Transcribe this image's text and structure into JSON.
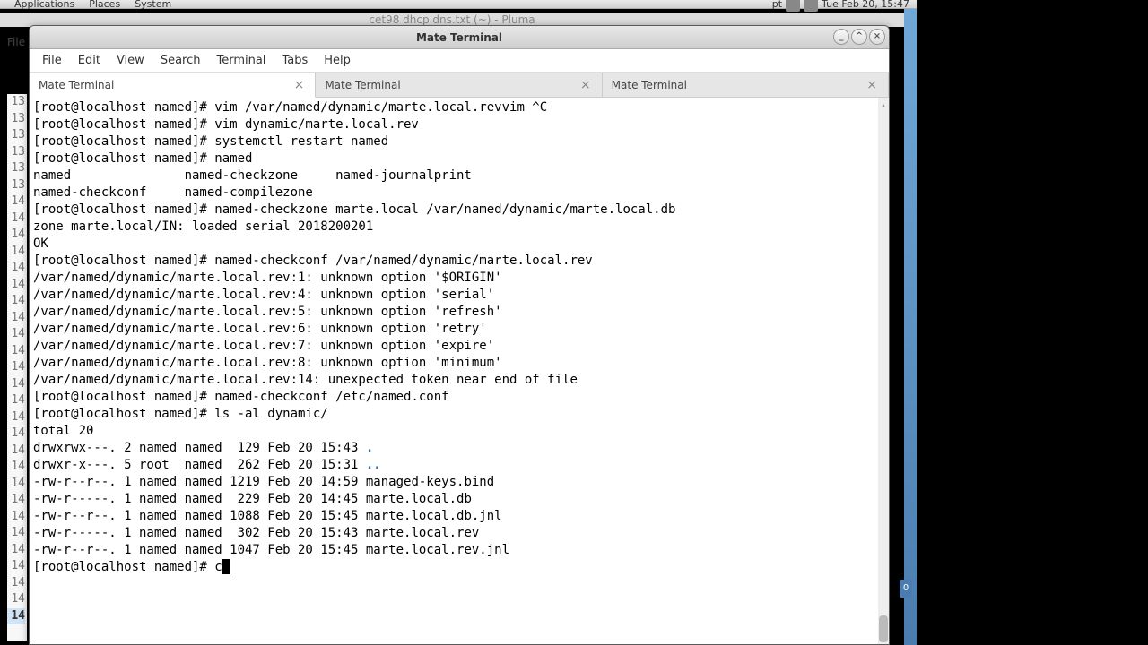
{
  "panel": {
    "apps": "Applications",
    "places": "Places",
    "system": "System",
    "lang": "pt",
    "clock": "Tue Feb 20, 15:47"
  },
  "bg_window": {
    "title": "cet98 dhcp dns.txt (~) - Pluma",
    "file_menu": "File"
  },
  "gutter": {
    "lines": [
      "13",
      "13",
      "13",
      "13",
      "13",
      "13",
      "14",
      "14",
      "14",
      "14",
      "14",
      "14",
      "14",
      "14",
      "14",
      "14",
      "14",
      "14",
      "14",
      "14",
      "14",
      "14",
      "14",
      "14",
      "14",
      "14",
      "14",
      "14",
      "14",
      "14",
      "14",
      "14"
    ],
    "current_idx": 31
  },
  "blue_badge": "0",
  "terminal": {
    "title": "Mate Terminal",
    "menus": [
      "File",
      "Edit",
      "View",
      "Search",
      "Terminal",
      "Tabs",
      "Help"
    ],
    "tabs": [
      {
        "label": "Mate Terminal",
        "active": true
      },
      {
        "label": "Mate Terminal",
        "active": false
      },
      {
        "label": "Mate Terminal",
        "active": false
      }
    ],
    "win_buttons": {
      "min": "_",
      "max": "^",
      "close": "×"
    },
    "prompt": "[root@localhost named]# ",
    "lines": [
      "[root@localhost named]# vim /var/named/dynamic/marte.local.revvim ^C",
      "[root@localhost named]# vim dynamic/marte.local.rev",
      "[root@localhost named]# systemctl restart named",
      "[root@localhost named]# named",
      "named               named-checkzone     named-journalprint",
      "named-checkconf     named-compilezone",
      "[root@localhost named]# named-checkzone marte.local /var/named/dynamic/marte.local.db",
      "zone marte.local/IN: loaded serial 2018200201",
      "OK",
      "[root@localhost named]# named-checkconf /var/named/dynamic/marte.local.rev",
      "/var/named/dynamic/marte.local.rev:1: unknown option '$ORIGIN'",
      "/var/named/dynamic/marte.local.rev:4: unknown option 'serial'",
      "/var/named/dynamic/marte.local.rev:5: unknown option 'refresh'",
      "/var/named/dynamic/marte.local.rev:6: unknown option 'retry'",
      "/var/named/dynamic/marte.local.rev:7: unknown option 'expire'",
      "/var/named/dynamic/marte.local.rev:8: unknown option 'minimum'",
      "/var/named/dynamic/marte.local.rev:14: unexpected token near end of file",
      "[root@localhost named]# named-checkconf /etc/named.conf",
      "[root@localhost named]# ls -al dynamic/",
      "total 20"
    ],
    "ls": [
      {
        "perm": "drwxrwx---.",
        "n": "2",
        "own": "named",
        "grp": "named",
        "size": "129",
        "date": "Feb 20 15:43",
        "name": ".",
        "dir": true
      },
      {
        "perm": "drwxr-x---.",
        "n": "5",
        "own": "root ",
        "grp": "named",
        "size": "262",
        "date": "Feb 20 15:31",
        "name": "..",
        "dir": true
      },
      {
        "perm": "-rw-r--r--.",
        "n": "1",
        "own": "named",
        "grp": "named",
        "size": "1219",
        "date": "Feb 20 14:59",
        "name": "managed-keys.bind",
        "dir": false
      },
      {
        "perm": "-rw-r-----.",
        "n": "1",
        "own": "named",
        "grp": "named",
        "size": "229",
        "date": "Feb 20 14:45",
        "name": "marte.local.db",
        "dir": false
      },
      {
        "perm": "-rw-r--r--.",
        "n": "1",
        "own": "named",
        "grp": "named",
        "size": "1088",
        "date": "Feb 20 15:45",
        "name": "marte.local.db.jnl",
        "dir": false
      },
      {
        "perm": "-rw-r-----.",
        "n": "1",
        "own": "named",
        "grp": "named",
        "size": "302",
        "date": "Feb 20 15:43",
        "name": "marte.local.rev",
        "dir": false
      },
      {
        "perm": "-rw-r--r--.",
        "n": "1",
        "own": "named",
        "grp": "named",
        "size": "1047",
        "date": "Feb 20 15:45",
        "name": "marte.local.rev.jnl",
        "dir": false
      }
    ],
    "current_input": "c"
  }
}
